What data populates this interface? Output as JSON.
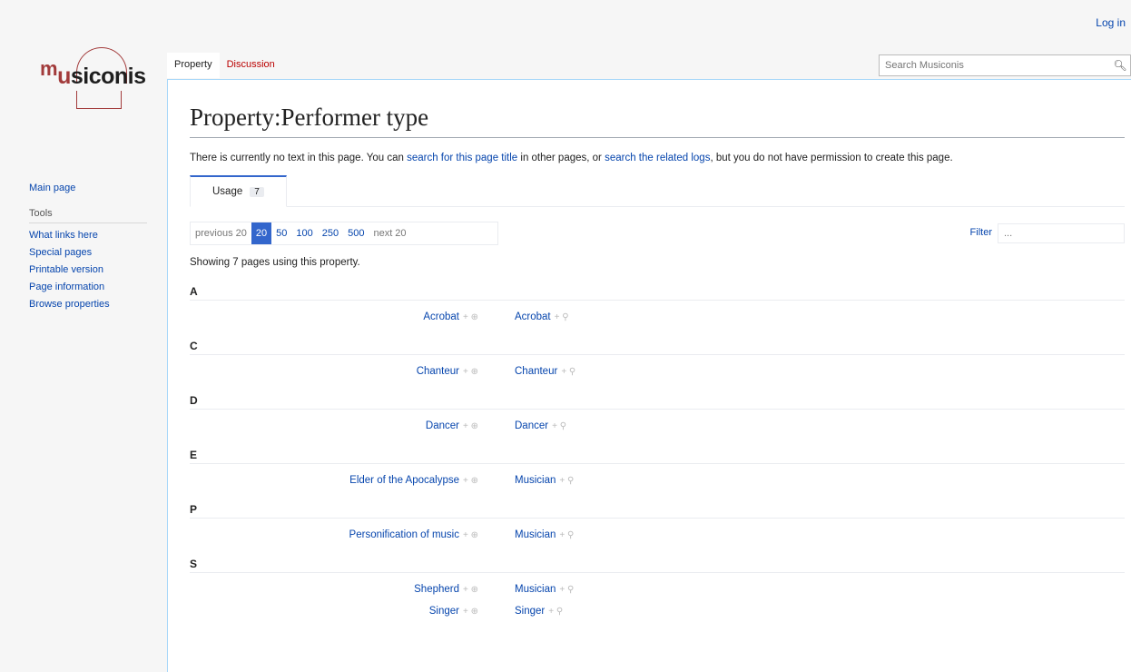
{
  "personal": {
    "login": "Log in"
  },
  "logo": {
    "m": "m",
    "u": "u",
    "rest": "siconis"
  },
  "tabs": [
    {
      "label": "Property"
    },
    {
      "label": "Discussion"
    }
  ],
  "search": {
    "placeholder": "Search Musiconis"
  },
  "sidebar": {
    "main_page": "Main page",
    "tools_heading": "Tools",
    "tools": [
      "What links here",
      "Special pages",
      "Printable version",
      "Page information",
      "Browse properties"
    ]
  },
  "page": {
    "title": "Property:Performer type",
    "intro_1": "There is currently no text in this page. You can ",
    "intro_link1": "search for this page title",
    "intro_2": " in other pages, or ",
    "intro_link2": "search the related logs",
    "intro_3": ", but you do not have permission to create this page."
  },
  "usage": {
    "label": "Usage",
    "count": "7"
  },
  "pager": {
    "prev": "previous 20",
    "sizes": [
      "20",
      "50",
      "100",
      "250",
      "500"
    ],
    "active": "20",
    "next": "next 20",
    "filter_label": "Filter",
    "filter_placeholder": "..."
  },
  "showing": "Showing 7 pages using this property.",
  "groups": [
    {
      "letter": "A",
      "rows": [
        {
          "subject": "Acrobat",
          "value": "Acrobat"
        }
      ]
    },
    {
      "letter": "C",
      "rows": [
        {
          "subject": "Chanteur",
          "value": "Chanteur"
        }
      ]
    },
    {
      "letter": "D",
      "rows": [
        {
          "subject": "Dancer",
          "value": "Dancer"
        }
      ]
    },
    {
      "letter": "E",
      "rows": [
        {
          "subject": "Elder of the Apocalypse",
          "value": "Musician"
        }
      ]
    },
    {
      "letter": "P",
      "rows": [
        {
          "subject": "Personification of music",
          "value": "Musician"
        }
      ]
    },
    {
      "letter": "S",
      "rows": [
        {
          "subject": "Shepherd",
          "value": "Musician"
        },
        {
          "subject": "Singer",
          "value": "Singer"
        }
      ]
    }
  ],
  "icons": {
    "browse": "+ ⊕",
    "search": "+ ⚲"
  }
}
